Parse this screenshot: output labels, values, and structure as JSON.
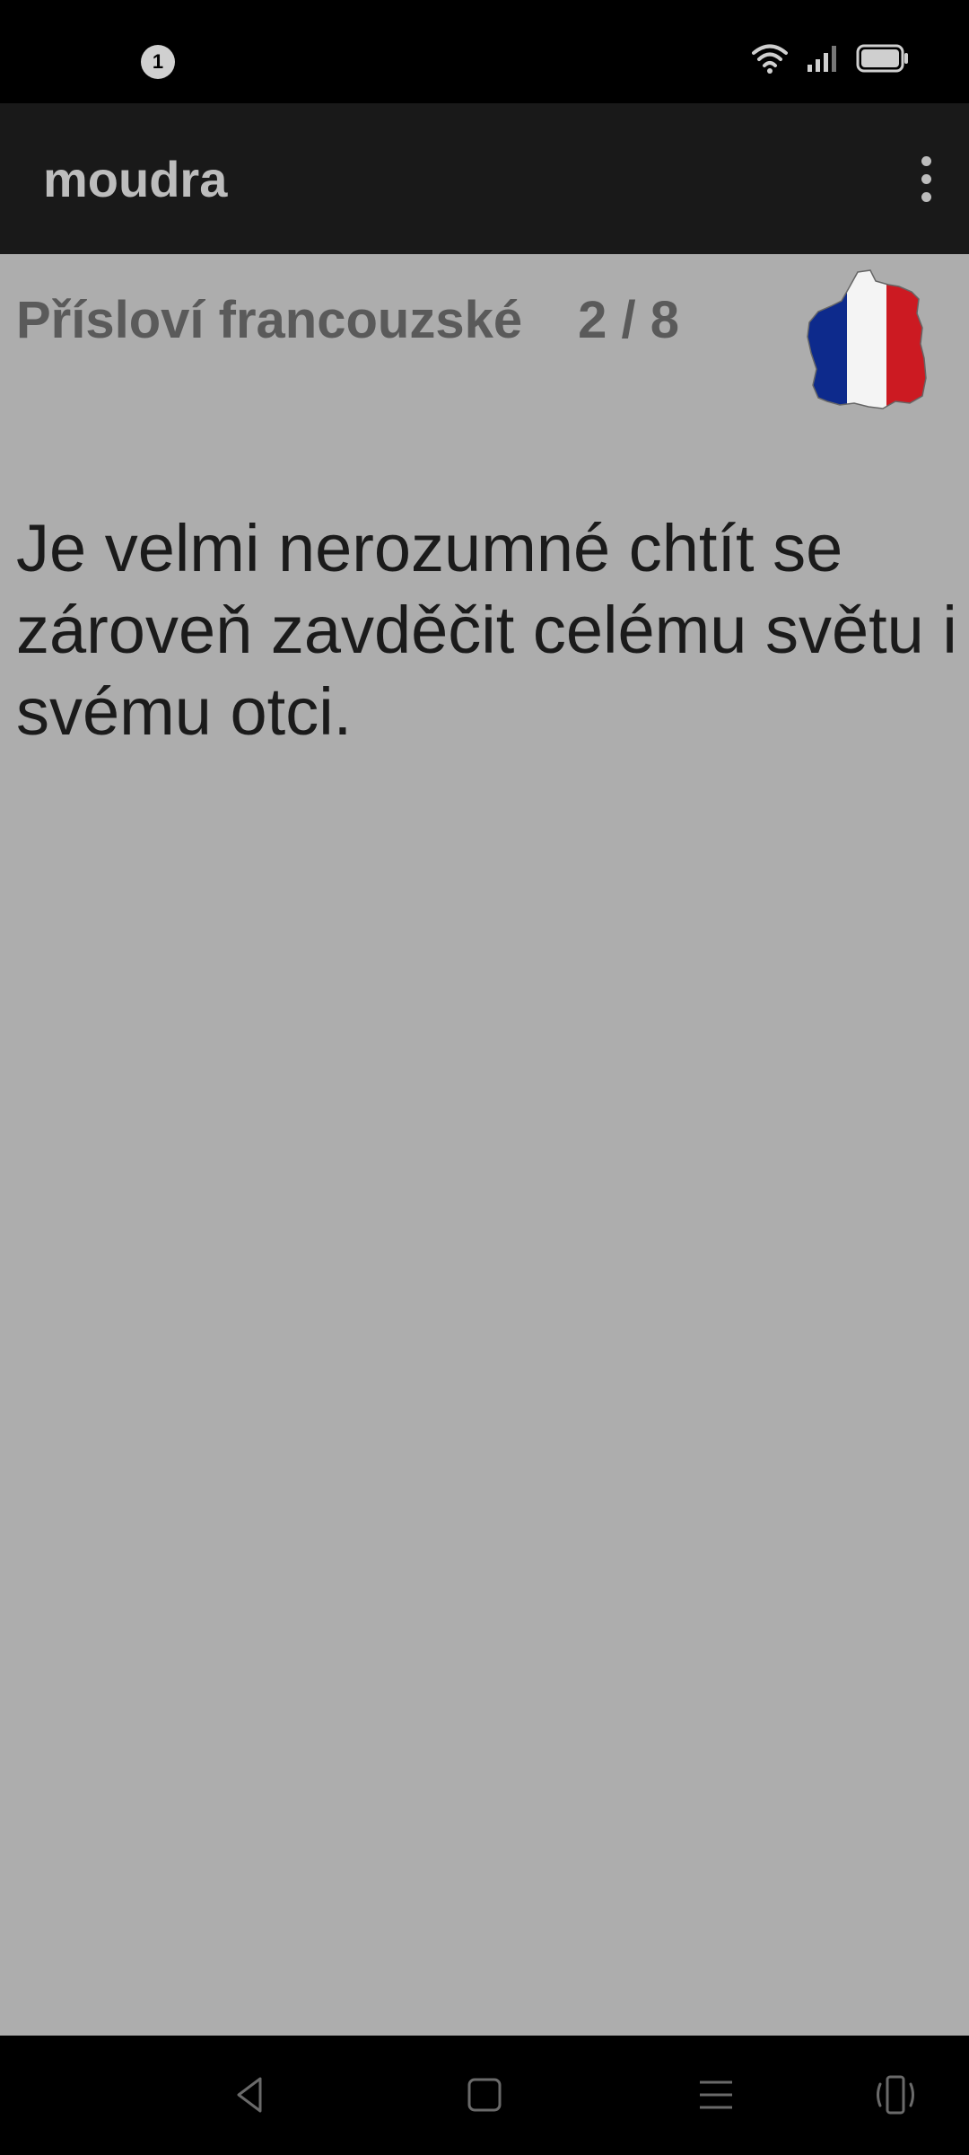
{
  "status_bar": {
    "notification_count": "1",
    "icons": [
      "wifi-icon",
      "signal-icon",
      "battery-icon"
    ]
  },
  "app_bar": {
    "title": "moudra",
    "menu_icon": "more-vert-icon"
  },
  "main": {
    "category_title": "Přísloví francouzské",
    "counter": "2 / 8",
    "flag_icon": "france-flag-map-icon",
    "proverb_text": "Je velmi nerozumné chtít se zároveň zavděčit celému světu i svému otci."
  },
  "nav_bar": {
    "icons": [
      "back-icon",
      "home-icon",
      "recents-icon",
      "rotate-icon"
    ]
  },
  "colors": {
    "content_bg": "#adadad",
    "app_bar_bg": "#191919",
    "flag_blue": "#0d2a8c",
    "flag_red": "#cc1a22"
  }
}
